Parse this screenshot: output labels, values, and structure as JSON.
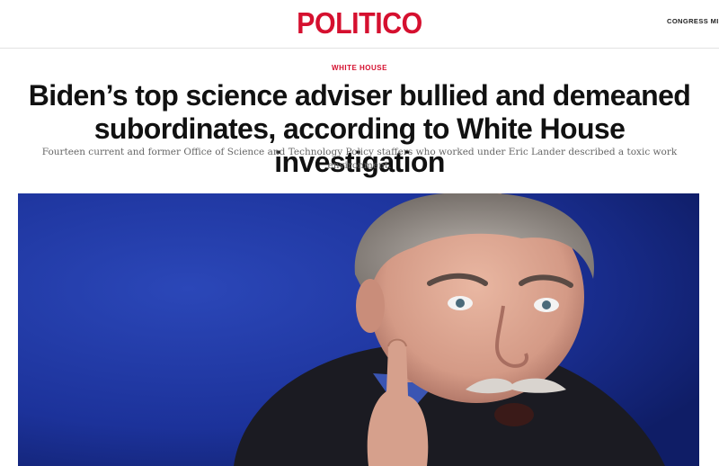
{
  "header": {
    "logo_text": "POLITICO",
    "nav_link": "CONGRESS MI",
    "brand_color": "#d5102f"
  },
  "article": {
    "section": "WHITE HOUSE",
    "headline": "Biden’s top science adviser bullied and demeaned subordinates, according to White House investigation",
    "dek": "Fourteen current and former Office of Science and Technology Policy staffers who worked under Eric Lander described a toxic work environment.",
    "hero_image": "portrait-photo"
  }
}
